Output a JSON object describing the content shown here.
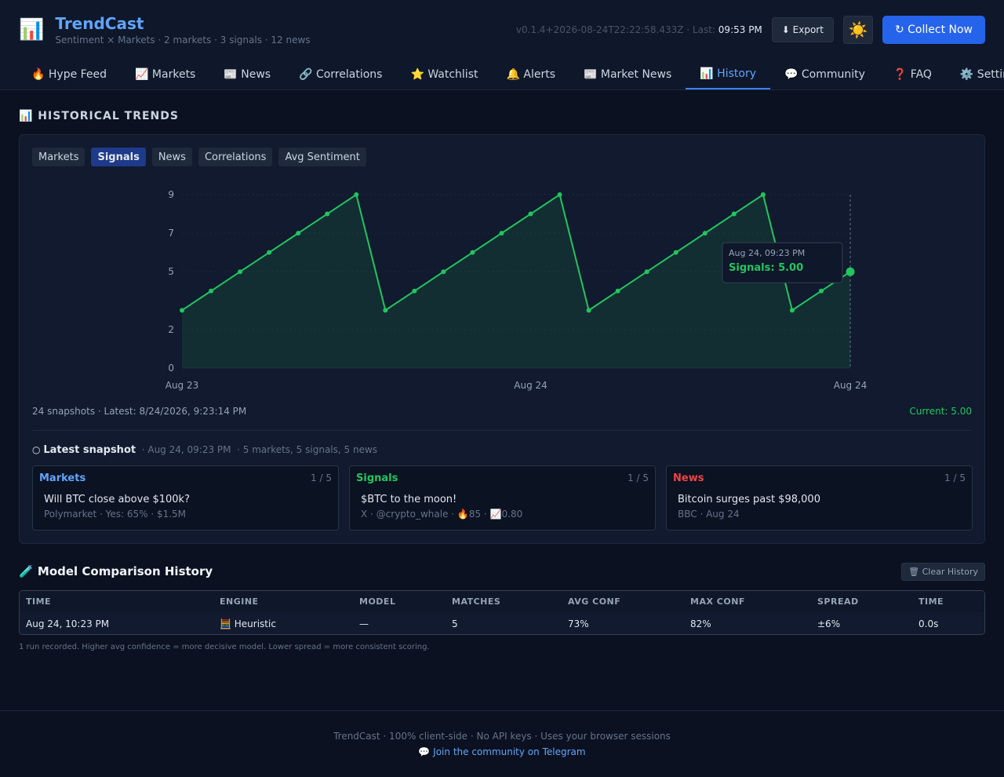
{
  "header": {
    "logo_icon": "📊",
    "title": "TrendCast",
    "subtitle": "Sentiment × Markets · 2 markets · 3 signals · 12 news",
    "version": "v0.1.4+2026-08-24T22:22:58.433Z · Last:",
    "last_time": "09:53 PM",
    "export_label": "⬇ Export",
    "theme_icon": "☀️",
    "collect_label": "↻ Collect Now"
  },
  "nav": {
    "tabs": [
      {
        "label": "🔥 Hype Feed"
      },
      {
        "label": "📈 Markets"
      },
      {
        "label": "📰 News"
      },
      {
        "label": "🔗 Correlations"
      },
      {
        "label": "⭐ Watchlist"
      },
      {
        "label": "🔔 Alerts"
      },
      {
        "label": "📰 Market News"
      },
      {
        "label": "📊 History"
      },
      {
        "label": "💬 Community"
      },
      {
        "label": "❓ FAQ"
      },
      {
        "label": "⚙️ Settings"
      }
    ],
    "active_index": 7
  },
  "history": {
    "section_title": "📊 HISTORICAL TRENDS",
    "subtabs": [
      "Markets",
      "Signals",
      "News",
      "Correlations",
      "Avg Sentiment"
    ],
    "active_subtab": 1,
    "summary": "24 snapshots · Latest: 8/24/2026, 9:23:14 PM",
    "current": "Current: 5.00",
    "snapshot": {
      "icon": "○",
      "title": "Latest snapshot",
      "meta": "· Aug 24, 09:23 PM",
      "counts": "· 5 markets, 5 signals, 5 news"
    },
    "cards": [
      {
        "title": "Markets",
        "color": "#60a5fa",
        "count": "1 / 5",
        "headline": "Will BTC close above $100k?",
        "meta": "Polymarket · Yes: 65% · $1.5M"
      },
      {
        "title": "Signals",
        "color": "#22c55e",
        "count": "1 / 5",
        "headline": "$BTC to the moon!",
        "meta": "X · @crypto_whale · 🔥85 · 📈0.80"
      },
      {
        "title": "News",
        "color": "#ef4444",
        "count": "1 / 5",
        "headline": "Bitcoin surges past $98,000",
        "meta": "BBC · Aug 24"
      }
    ]
  },
  "chart_data": {
    "type": "area",
    "color": "#22c55e",
    "y_ticks": [
      "0",
      "2",
      "5",
      "7",
      "9"
    ],
    "ylim": [
      0,
      9
    ],
    "x_tick_labels": [
      "Aug 23",
      "Aug 24",
      "Aug 24"
    ],
    "x_tick_indices": [
      0,
      12,
      23
    ],
    "series": [
      {
        "values": [
          3,
          4,
          5,
          6,
          7,
          8,
          9,
          3,
          4,
          5,
          6,
          7,
          8,
          9,
          3,
          4,
          5,
          6,
          7,
          8,
          9,
          3,
          4,
          5
        ]
      }
    ],
    "tooltip": {
      "time": "Aug 24, 09:23 PM",
      "value": "Signals: 5.00"
    },
    "grid": true
  },
  "model_comparison": {
    "title": "🧪 Model Comparison History",
    "clear_label": "🗑 Clear History",
    "columns": [
      "TIME",
      "ENGINE",
      "MODEL",
      "MATCHES",
      "AVG CONF",
      "MAX CONF",
      "SPREAD",
      "TIME"
    ],
    "rows": [
      [
        "Aug 24, 10:23 PM",
        "🧮 Heuristic",
        "—",
        "5",
        "73%",
        "82%",
        "±6%",
        "0.0s"
      ]
    ],
    "note": "1 run recorded. Higher avg confidence = more decisive model. Lower spread = more consistent scoring."
  },
  "footer": {
    "line1": "TrendCast · 100% client-side · No API keys · Uses your browser sessions",
    "line2": "💬 Join the community on Telegram"
  }
}
